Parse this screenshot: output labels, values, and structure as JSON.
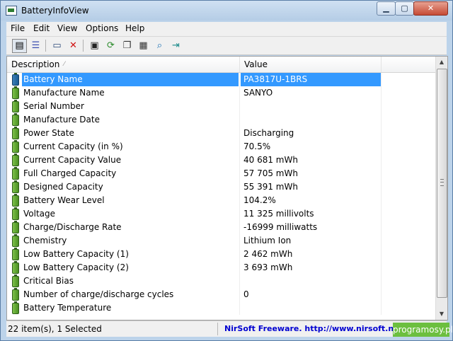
{
  "window": {
    "title": "BatteryInfoView"
  },
  "menu": {
    "file": "File",
    "edit": "Edit",
    "view": "View",
    "options": "Options",
    "help": "Help"
  },
  "toolbar": {
    "icons": [
      "details-view-icon",
      "list-view-icon",
      "properties-icon",
      "delete-icon",
      "save-icon",
      "refresh-icon",
      "copy-icon",
      "html-report-icon",
      "find-icon",
      "exit-icon"
    ]
  },
  "table": {
    "headers": {
      "description": "Description",
      "value": "Value"
    },
    "rows": [
      {
        "description": "Battery Name",
        "value": "PA3817U-1BRS"
      },
      {
        "description": "Manufacture Name",
        "value": "SANYO"
      },
      {
        "description": "Serial Number",
        "value": ""
      },
      {
        "description": "Manufacture Date",
        "value": ""
      },
      {
        "description": "Power State",
        "value": "Discharging"
      },
      {
        "description": "Current Capacity (in %)",
        "value": "70.5%"
      },
      {
        "description": "Current Capacity Value",
        "value": "40 681 mWh"
      },
      {
        "description": "Full Charged Capacity",
        "value": "57 705 mWh"
      },
      {
        "description": "Designed Capacity",
        "value": "55 391 mWh"
      },
      {
        "description": "Battery Wear Level",
        "value": "104.2%"
      },
      {
        "description": "Voltage",
        "value": "11 325 millivolts"
      },
      {
        "description": "Charge/Discharge Rate",
        "value": "-16999 milliwatts"
      },
      {
        "description": "Chemistry",
        "value": "Lithium Ion"
      },
      {
        "description": "Low Battery Capacity (1)",
        "value": "2 462 mWh"
      },
      {
        "description": "Low Battery Capacity (2)",
        "value": "3 693 mWh"
      },
      {
        "description": "Critical Bias",
        "value": ""
      },
      {
        "description": "Number of charge/discharge cycles",
        "value": "0"
      },
      {
        "description": "Battery Temperature",
        "value": ""
      }
    ],
    "selected_index": 0
  },
  "status": {
    "count": "22 item(s), 1 Selected",
    "nirsoft": "NirSoft Freeware.  http://www.nirsoft.net",
    "promo": "programosy.pl"
  },
  "colors": {
    "selection": "#3399ff",
    "nirsoft_link": "#0000d0",
    "promo_bg": "#6cbf3f"
  }
}
